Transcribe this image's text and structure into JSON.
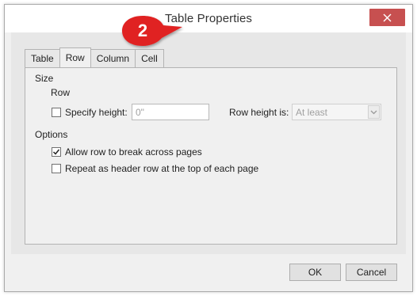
{
  "window": {
    "title": "Table Properties",
    "close_symbol": "✕"
  },
  "callout": {
    "number": "2",
    "color": "#e02020"
  },
  "tabs": [
    {
      "label": "Table"
    },
    {
      "label": "Row"
    },
    {
      "label": "Column"
    },
    {
      "label": "Cell"
    }
  ],
  "active_tab": "Row",
  "size_section": {
    "heading": "Size",
    "subheading": "Row",
    "specify_height_label": "Specify height:",
    "specify_height_checked": false,
    "height_value": "0\"",
    "row_height_is_label": "Row height is:",
    "row_height_is_value": "At least"
  },
  "options_section": {
    "heading": "Options",
    "allow_break_label": "Allow row to break across pages",
    "allow_break_checked": true,
    "repeat_header_label": "Repeat as header row at the top of each page",
    "repeat_header_checked": false
  },
  "buttons": {
    "ok": "OK",
    "cancel": "Cancel"
  }
}
